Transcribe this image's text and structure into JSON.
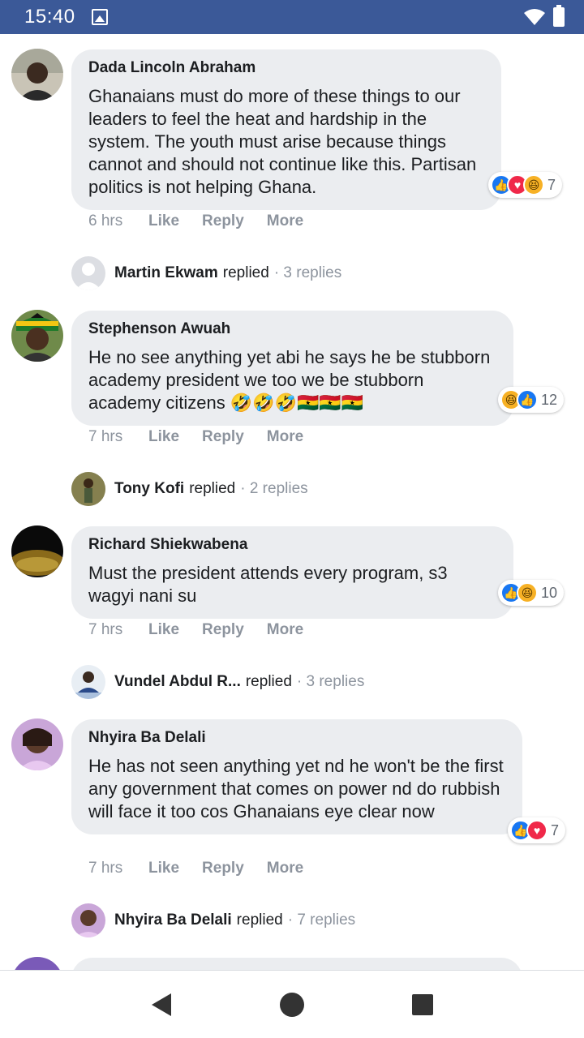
{
  "status_bar": {
    "time": "15:40"
  },
  "comments": [
    {
      "author": "Dada Lincoln Abraham",
      "text": "Ghanaians must do more of these things to our leaders to feel the heat and hardship in the system. The youth must arise because things cannot and should not continue like this. Partisan politics is not helping Ghana.",
      "reaction_count": "7",
      "reactions": [
        "like",
        "love",
        "haha"
      ],
      "time": "6 hrs",
      "reply": {
        "name": "Martin Ekwam",
        "verb": "replied",
        "count": "· 3 replies"
      }
    },
    {
      "author": "Stephenson Awuah",
      "text": "He no see anything yet abi he says he be stubborn academy president we too we be stubborn academy citizens 🤣🤣🤣🇬🇭🇬🇭🇬🇭",
      "reaction_count": "12",
      "reactions": [
        "haha",
        "like"
      ],
      "time": "7 hrs",
      "reply": {
        "name": "Tony Kofi",
        "verb": "replied",
        "count": "· 2 replies"
      }
    },
    {
      "author": "Richard Shiekwabena",
      "text": "Must the president attends every program, s3 wagyi nani su",
      "reaction_count": "10",
      "reactions": [
        "like",
        "haha"
      ],
      "time": "7 hrs",
      "reply": {
        "name": "Vundel Abdul R...",
        "verb": "replied",
        "count": "· 3 replies"
      }
    },
    {
      "author": "Nhyira Ba Delali",
      "text": "He has not seen anything yet nd he won't be the first any government that comes on power nd do rubbish will face it too cos Ghanaians eye clear now",
      "reaction_count": "7",
      "reactions": [
        "like",
        "love"
      ],
      "time": "7 hrs",
      "reply": {
        "name": "Nhyira Ba Delali",
        "verb": "replied",
        "count": "· 7 replies"
      }
    }
  ],
  "actions": {
    "like": "Like",
    "reply": "Reply",
    "more": "More"
  },
  "colors": {
    "status_bar": "#3b5998",
    "bubble": "#ebedf0",
    "like": "#1877f2",
    "love": "#f02849",
    "haha": "#f7b125"
  }
}
